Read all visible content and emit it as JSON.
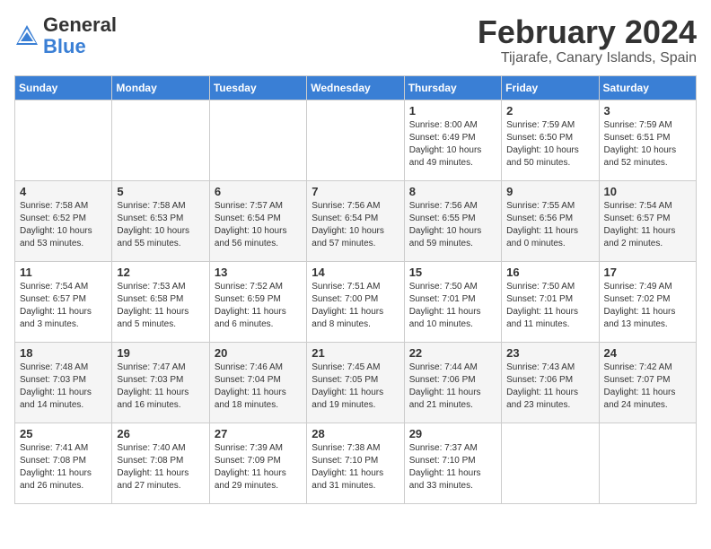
{
  "header": {
    "logo_general": "General",
    "logo_blue": "Blue",
    "month_title": "February 2024",
    "location": "Tijarafe, Canary Islands, Spain"
  },
  "days_of_week": [
    "Sunday",
    "Monday",
    "Tuesday",
    "Wednesday",
    "Thursday",
    "Friday",
    "Saturday"
  ],
  "weeks": [
    [
      {
        "day": "",
        "info": ""
      },
      {
        "day": "",
        "info": ""
      },
      {
        "day": "",
        "info": ""
      },
      {
        "day": "",
        "info": ""
      },
      {
        "day": "1",
        "info": "Sunrise: 8:00 AM\nSunset: 6:49 PM\nDaylight: 10 hours\nand 49 minutes."
      },
      {
        "day": "2",
        "info": "Sunrise: 7:59 AM\nSunset: 6:50 PM\nDaylight: 10 hours\nand 50 minutes."
      },
      {
        "day": "3",
        "info": "Sunrise: 7:59 AM\nSunset: 6:51 PM\nDaylight: 10 hours\nand 52 minutes."
      }
    ],
    [
      {
        "day": "4",
        "info": "Sunrise: 7:58 AM\nSunset: 6:52 PM\nDaylight: 10 hours\nand 53 minutes."
      },
      {
        "day": "5",
        "info": "Sunrise: 7:58 AM\nSunset: 6:53 PM\nDaylight: 10 hours\nand 55 minutes."
      },
      {
        "day": "6",
        "info": "Sunrise: 7:57 AM\nSunset: 6:54 PM\nDaylight: 10 hours\nand 56 minutes."
      },
      {
        "day": "7",
        "info": "Sunrise: 7:56 AM\nSunset: 6:54 PM\nDaylight: 10 hours\nand 57 minutes."
      },
      {
        "day": "8",
        "info": "Sunrise: 7:56 AM\nSunset: 6:55 PM\nDaylight: 10 hours\nand 59 minutes."
      },
      {
        "day": "9",
        "info": "Sunrise: 7:55 AM\nSunset: 6:56 PM\nDaylight: 11 hours\nand 0 minutes."
      },
      {
        "day": "10",
        "info": "Sunrise: 7:54 AM\nSunset: 6:57 PM\nDaylight: 11 hours\nand 2 minutes."
      }
    ],
    [
      {
        "day": "11",
        "info": "Sunrise: 7:54 AM\nSunset: 6:57 PM\nDaylight: 11 hours\nand 3 minutes."
      },
      {
        "day": "12",
        "info": "Sunrise: 7:53 AM\nSunset: 6:58 PM\nDaylight: 11 hours\nand 5 minutes."
      },
      {
        "day": "13",
        "info": "Sunrise: 7:52 AM\nSunset: 6:59 PM\nDaylight: 11 hours\nand 6 minutes."
      },
      {
        "day": "14",
        "info": "Sunrise: 7:51 AM\nSunset: 7:00 PM\nDaylight: 11 hours\nand 8 minutes."
      },
      {
        "day": "15",
        "info": "Sunrise: 7:50 AM\nSunset: 7:01 PM\nDaylight: 11 hours\nand 10 minutes."
      },
      {
        "day": "16",
        "info": "Sunrise: 7:50 AM\nSunset: 7:01 PM\nDaylight: 11 hours\nand 11 minutes."
      },
      {
        "day": "17",
        "info": "Sunrise: 7:49 AM\nSunset: 7:02 PM\nDaylight: 11 hours\nand 13 minutes."
      }
    ],
    [
      {
        "day": "18",
        "info": "Sunrise: 7:48 AM\nSunset: 7:03 PM\nDaylight: 11 hours\nand 14 minutes."
      },
      {
        "day": "19",
        "info": "Sunrise: 7:47 AM\nSunset: 7:03 PM\nDaylight: 11 hours\nand 16 minutes."
      },
      {
        "day": "20",
        "info": "Sunrise: 7:46 AM\nSunset: 7:04 PM\nDaylight: 11 hours\nand 18 minutes."
      },
      {
        "day": "21",
        "info": "Sunrise: 7:45 AM\nSunset: 7:05 PM\nDaylight: 11 hours\nand 19 minutes."
      },
      {
        "day": "22",
        "info": "Sunrise: 7:44 AM\nSunset: 7:06 PM\nDaylight: 11 hours\nand 21 minutes."
      },
      {
        "day": "23",
        "info": "Sunrise: 7:43 AM\nSunset: 7:06 PM\nDaylight: 11 hours\nand 23 minutes."
      },
      {
        "day": "24",
        "info": "Sunrise: 7:42 AM\nSunset: 7:07 PM\nDaylight: 11 hours\nand 24 minutes."
      }
    ],
    [
      {
        "day": "25",
        "info": "Sunrise: 7:41 AM\nSunset: 7:08 PM\nDaylight: 11 hours\nand 26 minutes."
      },
      {
        "day": "26",
        "info": "Sunrise: 7:40 AM\nSunset: 7:08 PM\nDaylight: 11 hours\nand 27 minutes."
      },
      {
        "day": "27",
        "info": "Sunrise: 7:39 AM\nSunset: 7:09 PM\nDaylight: 11 hours\nand 29 minutes."
      },
      {
        "day": "28",
        "info": "Sunrise: 7:38 AM\nSunset: 7:10 PM\nDaylight: 11 hours\nand 31 minutes."
      },
      {
        "day": "29",
        "info": "Sunrise: 7:37 AM\nSunset: 7:10 PM\nDaylight: 11 hours\nand 33 minutes."
      },
      {
        "day": "",
        "info": ""
      },
      {
        "day": "",
        "info": ""
      }
    ]
  ]
}
